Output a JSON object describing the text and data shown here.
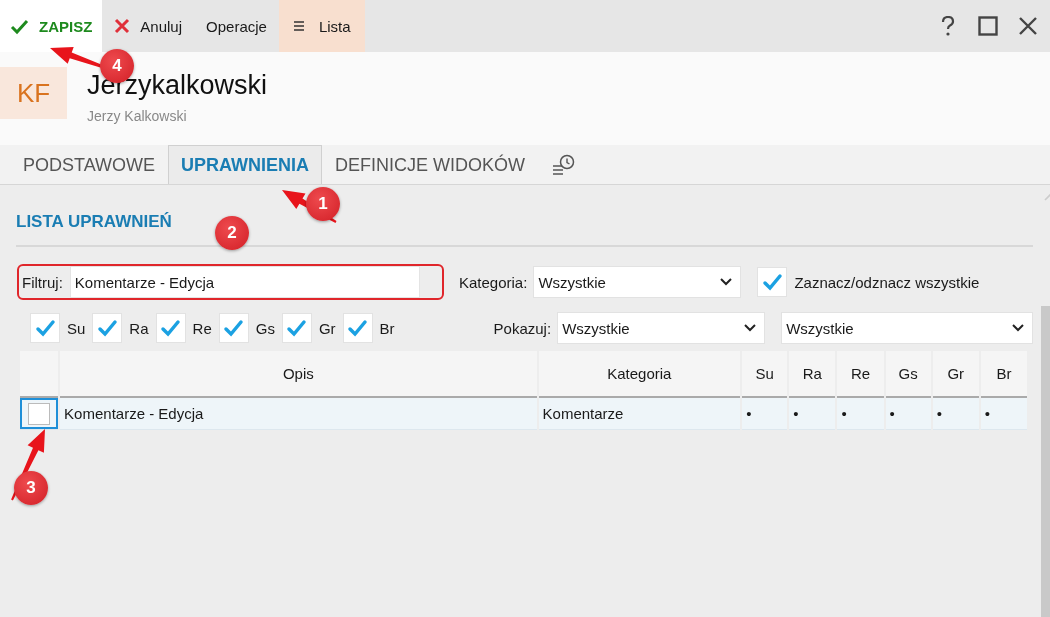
{
  "toolbar": {
    "buttons": [
      {
        "label": "ZAPISZ",
        "kind": "save",
        "selected": false
      },
      {
        "label": "Anuluj",
        "kind": "cancel",
        "selected": false
      },
      {
        "label": "Operacje",
        "kind": "plain",
        "selected": false
      },
      {
        "label": "Lista",
        "kind": "list",
        "selected": true
      }
    ]
  },
  "header": {
    "avatar": "KF",
    "title": "Jerzykalkowski",
    "subtitle": "Jerzy Kalkowski"
  },
  "tabs": [
    {
      "label": "PODSTAWOWE",
      "selected": false
    },
    {
      "label": "UPRAWNIENIA",
      "selected": true
    },
    {
      "label": "DEFINICJE WIDOKÓW",
      "selected": false
    }
  ],
  "section_title": "LISTA UPRAWNIEŃ",
  "filter": {
    "label": "Filtruj:",
    "value": "Komentarze - Edycja"
  },
  "category": {
    "label": "Kategoria:",
    "value": "Wszystkie"
  },
  "select_all": {
    "label": "Zaznacz/odznacz wszystkie",
    "checked": true
  },
  "column_filters": [
    {
      "label": "Su",
      "checked": true
    },
    {
      "label": "Ra",
      "checked": true
    },
    {
      "label": "Re",
      "checked": true
    },
    {
      "label": "Gs",
      "checked": true
    },
    {
      "label": "Gr",
      "checked": true
    },
    {
      "label": "Br",
      "checked": true
    }
  ],
  "show": {
    "label": "Pokazuj:",
    "value": "Wszystkie",
    "value_2": "Wszystkie"
  },
  "table": {
    "columns": [
      "Opis",
      "Kategoria",
      "Su",
      "Ra",
      "Re",
      "Gs",
      "Gr",
      "Br"
    ],
    "rows": [
      {
        "checked": false,
        "selected": true,
        "cells": [
          "Komentarze - Edycja",
          "Komentarze",
          "•",
          "•",
          "•",
          "•",
          "•",
          "•"
        ]
      }
    ]
  },
  "annotations": [
    {
      "number": "1"
    },
    {
      "number": "2"
    },
    {
      "number": "3"
    },
    {
      "number": "4"
    }
  ]
}
